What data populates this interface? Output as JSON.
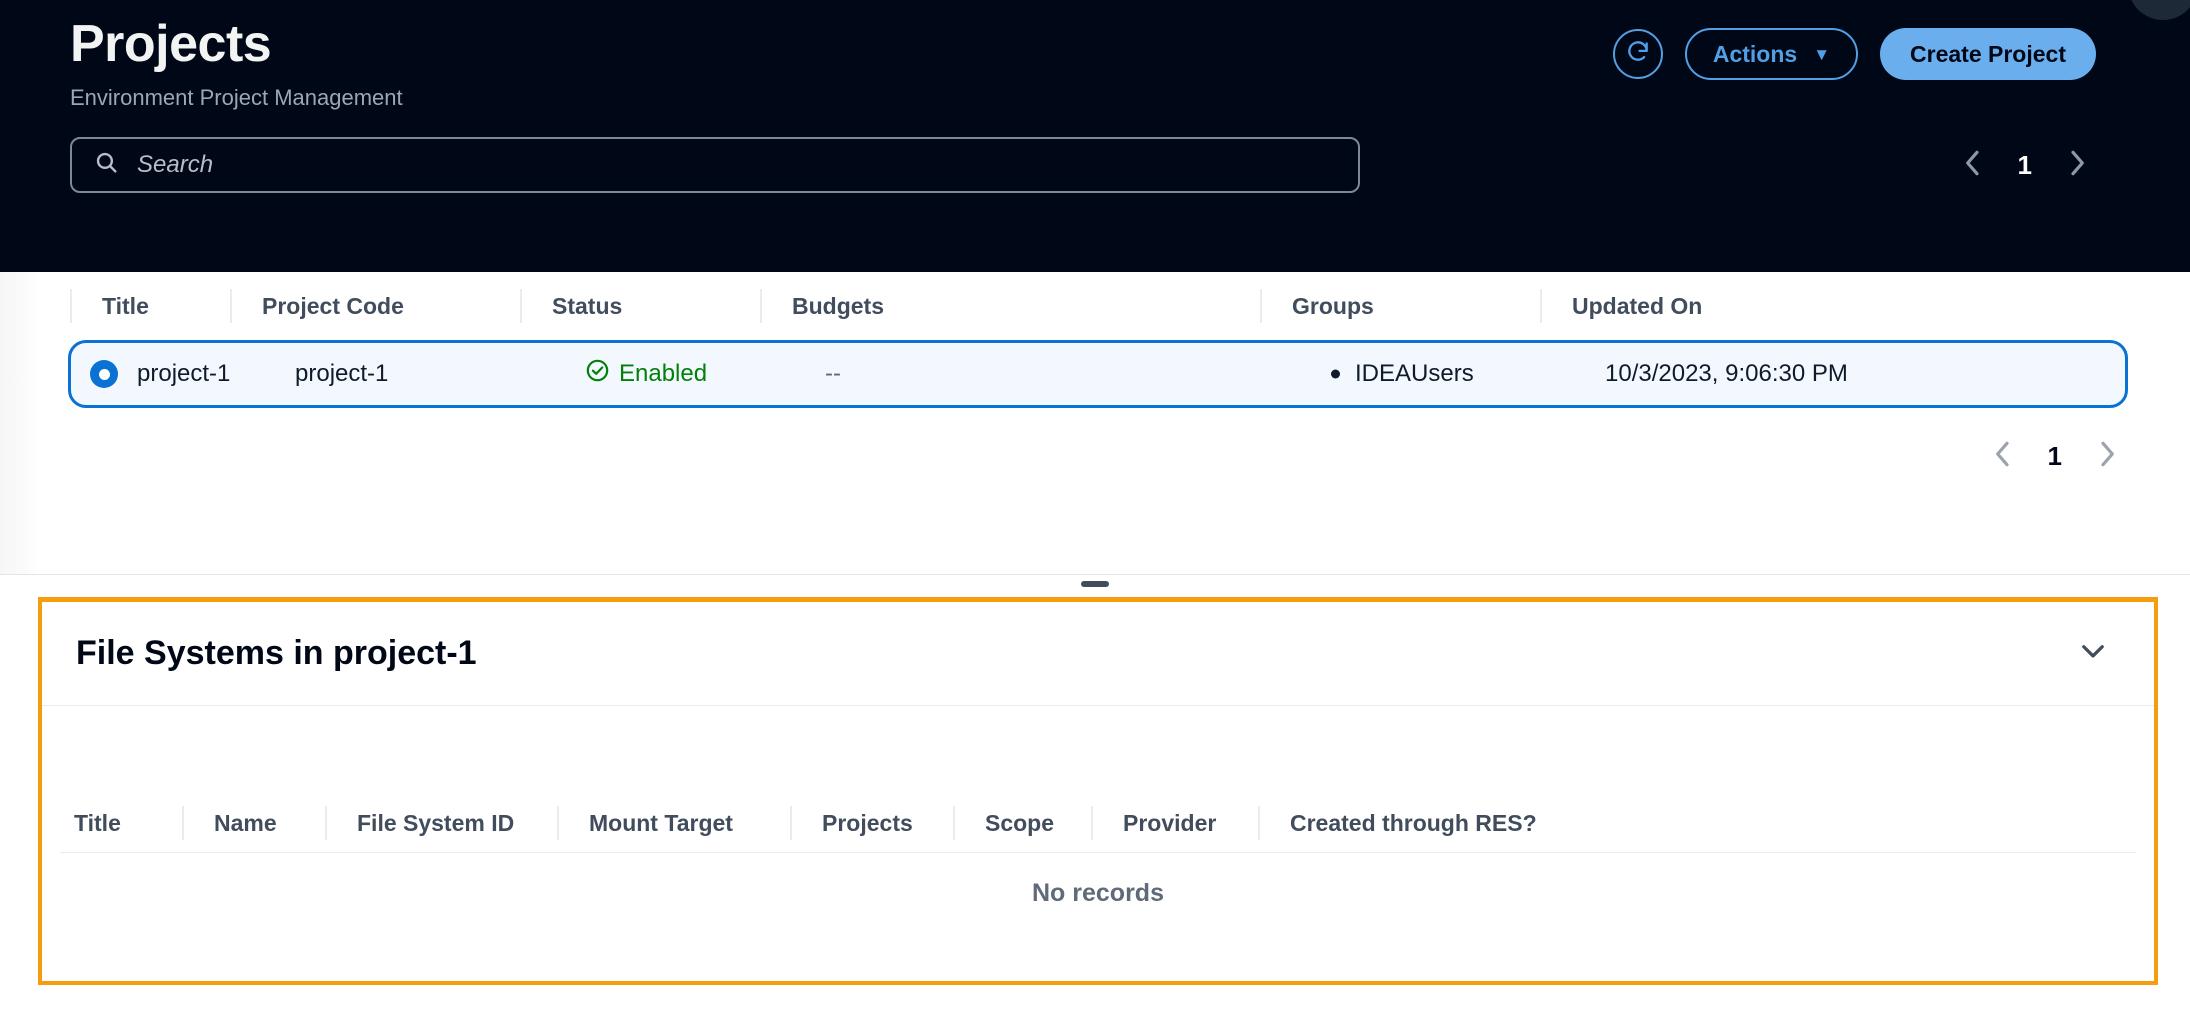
{
  "header": {
    "title": "Projects",
    "subtitle": "Environment Project Management",
    "refresh_icon": "refresh-icon",
    "actions_label": "Actions",
    "actions_caret": "▼",
    "create_label": "Create Project"
  },
  "search": {
    "icon": "search-icon",
    "placeholder": "Search",
    "value": ""
  },
  "pagination_top": {
    "prev_icon": "chevron-left-icon",
    "page": "1",
    "next_icon": "chevron-right-icon"
  },
  "pagination_bottom": {
    "prev_icon": "chevron-left-icon",
    "page": "1",
    "next_icon": "chevron-right-icon"
  },
  "projects_table": {
    "columns": [
      {
        "key": "title",
        "label": "Title"
      },
      {
        "key": "project_code",
        "label": "Project Code"
      },
      {
        "key": "status",
        "label": "Status"
      },
      {
        "key": "budgets",
        "label": "Budgets"
      },
      {
        "key": "groups",
        "label": "Groups"
      },
      {
        "key": "updated_on",
        "label": "Updated On"
      }
    ],
    "rows": [
      {
        "selected": true,
        "title": "project-1",
        "project_code": "project-1",
        "status": "Enabled",
        "status_icon": "status-success-icon",
        "status_color": "#037f0c",
        "budgets": "--",
        "groups": [
          "IDEAUsers"
        ],
        "updated_on": "10/3/2023, 9:06:30 PM"
      }
    ]
  },
  "splitter": {
    "handle": "splitter-drag-handle"
  },
  "file_systems_panel": {
    "title": "File Systems in project-1",
    "collapse_icon": "chevron-down-icon",
    "border_color": "#f59d0e",
    "columns": [
      {
        "key": "title",
        "label": "Title"
      },
      {
        "key": "name",
        "label": "Name"
      },
      {
        "key": "file_system_id",
        "label": "File System ID"
      },
      {
        "key": "mount_target",
        "label": "Mount Target"
      },
      {
        "key": "projects",
        "label": "Projects"
      },
      {
        "key": "scope",
        "label": "Scope"
      },
      {
        "key": "provider",
        "label": "Provider"
      },
      {
        "key": "created_through_res",
        "label": "Created through RES?"
      }
    ],
    "rows": [],
    "empty_message": "No records"
  },
  "colors": {
    "header_bg": "#000716",
    "accent_blue": "#0972d3",
    "link_blue": "#539fe5",
    "primary_btn": "#6aaeed",
    "success_green": "#037f0c",
    "panel_orange": "#f59d0e"
  }
}
